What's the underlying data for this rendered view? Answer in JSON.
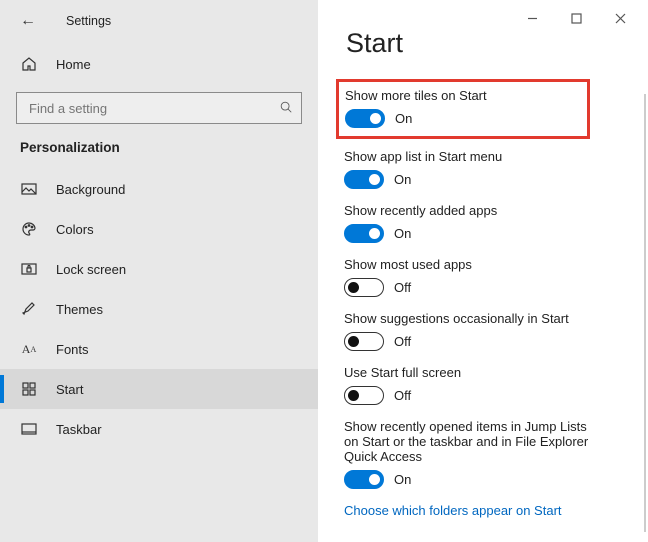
{
  "appTitle": "Settings",
  "homeLabel": "Home",
  "searchPlaceholder": "Find a setting",
  "sectionLabel": "Personalization",
  "nav": [
    {
      "label": "Background"
    },
    {
      "label": "Colors"
    },
    {
      "label": "Lock screen"
    },
    {
      "label": "Themes"
    },
    {
      "label": "Fonts"
    },
    {
      "label": "Start"
    },
    {
      "label": "Taskbar"
    }
  ],
  "pageTitle": "Start",
  "stateOn": "On",
  "stateOff": "Off",
  "options": [
    {
      "label": "Show more tiles on Start",
      "on": true
    },
    {
      "label": "Show app list in Start menu",
      "on": true
    },
    {
      "label": "Show recently added apps",
      "on": true
    },
    {
      "label": "Show most used apps",
      "on": false
    },
    {
      "label": "Show suggestions occasionally in Start",
      "on": false
    },
    {
      "label": "Use Start full screen",
      "on": false
    },
    {
      "label": "Show recently opened items in Jump Lists on Start or the taskbar and in File Explorer Quick Access",
      "on": true
    }
  ],
  "linkText": "Choose which folders appear on Start"
}
